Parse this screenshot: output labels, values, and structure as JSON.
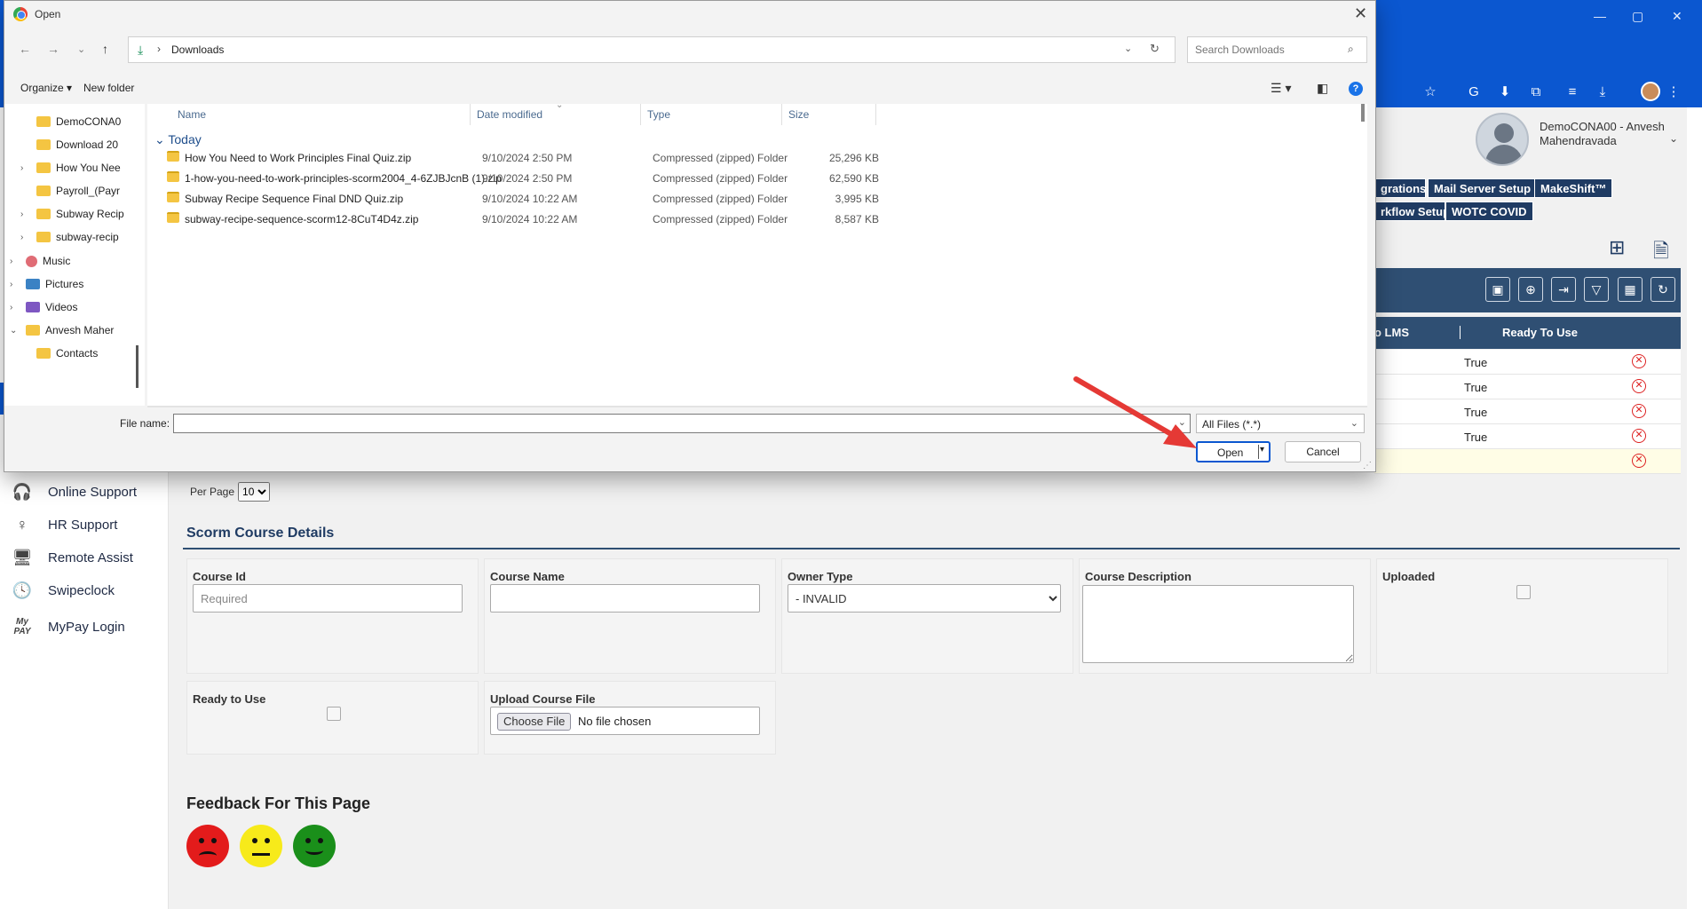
{
  "browser": {
    "window_controls": [
      "—",
      "▢",
      "✕"
    ]
  },
  "app": {
    "user": {
      "name": "DemoCONA00 - Anvesh Mahendravada"
    },
    "nav_tabs": [
      "grations",
      "Mail Server Setup",
      "MakeShift™",
      "rkflow Setup",
      "WOTC COVID"
    ],
    "sidebar": [
      {
        "label": "Online Support",
        "icon": "headset-icon"
      },
      {
        "label": "HR Support",
        "icon": "hr-support-icon"
      },
      {
        "label": "Remote Assist",
        "icon": "monitor-icon"
      },
      {
        "label": "Swipeclock",
        "icon": "clock-icon"
      },
      {
        "label": "MyPay Login",
        "icon": "mypay-logo-icon"
      }
    ],
    "grid": {
      "col_lms": "o LMS",
      "col_ready": "Ready To Use",
      "rows": [
        "True",
        "True",
        "True",
        "True"
      ]
    },
    "per_page": {
      "label": "Per Page",
      "value": "10"
    },
    "scorm": {
      "title": "Scorm Course Details",
      "course_id_label": "Course Id",
      "course_id_placeholder": "Required",
      "course_name_label": "Course Name",
      "owner_type_label": "Owner Type",
      "owner_type_value": "- INVALID",
      "course_desc_label": "Course Description",
      "uploaded_label": "Uploaded",
      "ready_label": "Ready to Use",
      "upload_label": "Upload Course File",
      "choose_file": "Choose File",
      "no_file": "No file chosen"
    },
    "feedback": {
      "title": "Feedback For This Page"
    }
  },
  "dialog": {
    "title": "Open",
    "path": "Downloads",
    "search_placeholder": "Search Downloads",
    "organize": "Organize ▾",
    "new_folder": "New folder",
    "tree": [
      {
        "label": "DemoCONA0",
        "expand": ""
      },
      {
        "label": "Download 20",
        "expand": ""
      },
      {
        "label": "How You Nee",
        "expand": "›"
      },
      {
        "label": "Payroll_(Payr",
        "expand": ""
      },
      {
        "label": "Subway Recip",
        "expand": "›"
      },
      {
        "label": "subway-recip",
        "expand": "›"
      },
      {
        "label": "Music",
        "expand": "›"
      },
      {
        "label": "Pictures",
        "expand": "›"
      },
      {
        "label": "Videos",
        "expand": "›"
      },
      {
        "label": "Anvesh Maher",
        "expand": "⌄"
      },
      {
        "label": "Contacts",
        "expand": ""
      }
    ],
    "columns": {
      "name": "Name",
      "date": "Date modified",
      "type": "Type",
      "size": "Size"
    },
    "group": "Today",
    "files": [
      {
        "name": "How You Need to Work Principles Final Quiz.zip",
        "date": "9/10/2024 2:50 PM",
        "type": "Compressed (zipped) Folder",
        "size": "25,296 KB"
      },
      {
        "name": "1-how-you-need-to-work-principles-scorm2004_4-6ZJBJcnB (1).zip",
        "date": "9/10/2024 2:50 PM",
        "type": "Compressed (zipped) Folder",
        "size": "62,590 KB"
      },
      {
        "name": "Subway Recipe Sequence Final DND Quiz.zip",
        "date": "9/10/2024 10:22 AM",
        "type": "Compressed (zipped) Folder",
        "size": "3,995 KB"
      },
      {
        "name": "subway-recipe-sequence-scorm12-8CuT4D4z.zip",
        "date": "9/10/2024 10:22 AM",
        "type": "Compressed (zipped) Folder",
        "size": "8,587 KB"
      }
    ],
    "file_name_label": "File name:",
    "file_name_value": "",
    "filter": "All Files (*.*)",
    "open": "Open",
    "cancel": "Cancel"
  },
  "colors": {
    "chrome": "#0b57d0",
    "app_navy": "#1f3b63",
    "grid_header": "#2f4f73",
    "arrow": "#e53935"
  }
}
